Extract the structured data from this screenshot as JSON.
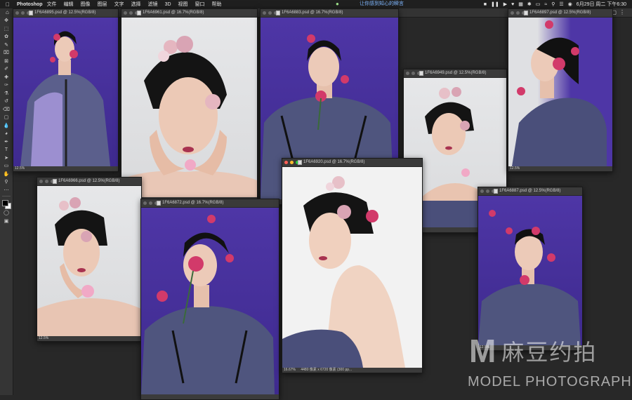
{
  "menubar": {
    "app": "Photoshop",
    "items": [
      "文件",
      "编辑",
      "图像",
      "图层",
      "文字",
      "选择",
      "滤镜",
      "3D",
      "视图",
      "窗口",
      "帮助"
    ],
    "tip": "让你感到知心的瞬言",
    "clock": "6月29日 周二 下午6:30"
  },
  "windows": [
    {
      "title": "1F6A6895.psd @ 12.5%(RGB/8)",
      "zoom": "12.5%",
      "bg": "purple"
    },
    {
      "title": "1F6A6961.psd @ 16.7%(RGB/8)",
      "zoom": "",
      "bg": "grey"
    },
    {
      "title": "1F6A6883.psd @ 16.7%(RGB/8)",
      "zoom": "",
      "bg": "purple"
    },
    {
      "title": "1F6A6949.psd @ 12.5%(RGB/8)",
      "zoom": "",
      "bg": "grey"
    },
    {
      "title": "1F6A6897.psd @ 12.5%(RGB/8)",
      "zoom": "12.5%",
      "bg": "purple"
    },
    {
      "title": "1F6A6966.psd @ 12.5%(RGB/8)",
      "zoom": "12.5%",
      "bg": "grey"
    },
    {
      "title": "1F6A6872.psd @ 16.7%(RGB/8)",
      "zoom": "",
      "bg": "purple"
    },
    {
      "title": "1F6A6920.psd @ 16.7%(RGB/8)",
      "zoom": "16.67%",
      "info": "4480 像素 x 6720 像素 (300 pp...",
      "bg": "grey"
    },
    {
      "title": "1F6A6887.psd @ 12.5%(RGB/8)",
      "zoom": "12.5%",
      "bg": "purple"
    }
  ],
  "watermark": {
    "logo_letter": "M",
    "brand_cn": "麻豆约拍",
    "brand_en": "MODEL PHOTOGRAPH"
  },
  "colors": {
    "purple_backdrop": "#4e36a6",
    "grey_backdrop": "#e2e3e5",
    "flower_pink": "#d23a6a",
    "jacket": "#4a4f7a"
  },
  "tools": [
    "move-tool",
    "marquee-tool",
    "lasso-tool",
    "quick-select-tool",
    "crop-tool",
    "frame-tool",
    "eyedropper-tool",
    "healing-tool",
    "brush-tool",
    "stamp-tool",
    "history-brush-tool",
    "eraser-tool",
    "gradient-tool",
    "blur-tool",
    "dodge-tool",
    "pen-tool",
    "type-tool",
    "path-select-tool",
    "rectangle-tool",
    "hand-tool",
    "zoom-tool",
    "more-tools"
  ]
}
